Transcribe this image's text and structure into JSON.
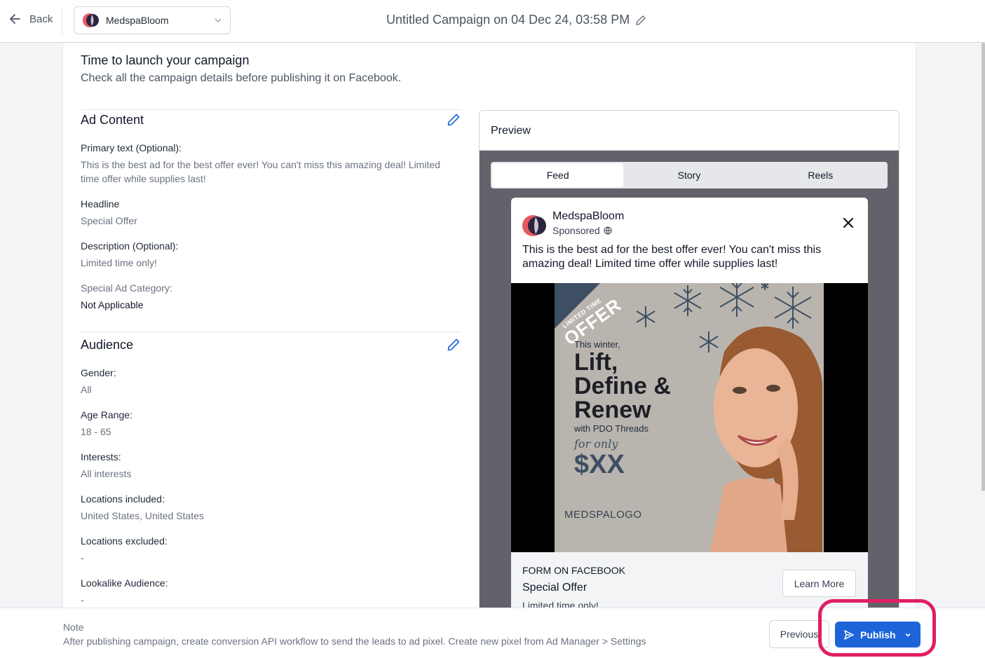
{
  "header": {
    "back_label": "Back",
    "account_name": "MedspaBloom",
    "campaign_title": "Untitled Campaign on 04 Dec 24, 03:58 PM"
  },
  "launch": {
    "title": "Time to launch your campaign",
    "subtitle": "Check all the campaign details before publishing it on Facebook."
  },
  "ad_content": {
    "title": "Ad Content",
    "primary_text_label": "Primary text (Optional):",
    "primary_text": "This is the best ad for the best offer ever! You can't miss this amazing deal! Limited time offer while supplies last!",
    "headline_label": "Headline",
    "headline": "Special Offer",
    "description_label": "Description (Optional):",
    "description": "Limited time only!",
    "category_label": "Special Ad Category:",
    "category": "Not Applicable"
  },
  "audience": {
    "title": "Audience",
    "gender_label": "Gender:",
    "gender": "All",
    "age_label": "Age Range:",
    "age": "18 - 65",
    "interests_label": "Interests:",
    "interests": "All interests",
    "loc_inc_label": "Locations included:",
    "loc_inc": "United States, United States",
    "loc_exc_label": "Locations excluded:",
    "loc_exc": "-",
    "lookalike_label": "Lookalike Audience:",
    "lookalike": "-"
  },
  "preview": {
    "title": "Preview",
    "tabs": [
      {
        "label": "Feed",
        "active": true
      },
      {
        "label": "Story",
        "active": false
      },
      {
        "label": "Reels",
        "active": false
      }
    ],
    "post": {
      "page_name": "MedspaBloom",
      "sponsored": "Sponsored",
      "text": "This is the best ad for the best offer ever! You can't miss this amazing deal! Limited time offer while supplies last!",
      "form_label": "FORM ON FACEBOOK",
      "headline": "Special Offer",
      "description": "Limited time only!",
      "cta": "Learn More"
    },
    "creative": {
      "ribbon_small": "LIMITED TIME",
      "ribbon_big": "OFFER",
      "line1": "This winter,",
      "line2": "Lift,",
      "line3": "Define &",
      "line4": "Renew",
      "line5": "with PDO Threads",
      "line6": "for only",
      "price": "$XX",
      "logo": "MEDSPALOGO"
    }
  },
  "footer": {
    "note_label": "Note",
    "note_text": "After publishing campaign, create conversion API workflow to send the leads to ad pixel. Create new pixel from Ad Manager > Settings",
    "previous_label": "Previous",
    "publish_label": "Publish"
  },
  "colors": {
    "primary": "#1d64d8",
    "highlight": "#e11d63",
    "preview_bg": "#63626a"
  }
}
